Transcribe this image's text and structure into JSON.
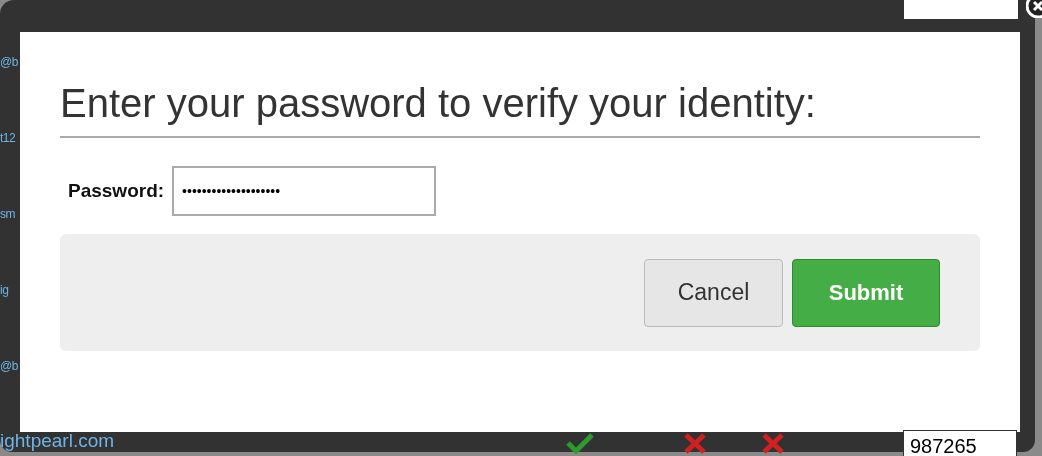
{
  "background_page": {
    "left_texts": [
      "@b",
      "t12",
      "sm",
      "ig",
      "@b"
    ],
    "bottom_link": "ightpearl.com",
    "status_icons": [
      {
        "kind": "check"
      },
      {
        "kind": "cross"
      },
      {
        "kind": "cross"
      }
    ],
    "id_field": {
      "value": "987265"
    }
  },
  "dialog": {
    "title": "Enter your password to verify your identity:",
    "password": {
      "label": "Password:",
      "value": "••••••••••••••••••••"
    },
    "buttons": [
      {
        "label": "Cancel",
        "kind": "secondary"
      },
      {
        "label": "Submit",
        "kind": "primary"
      }
    ]
  }
}
